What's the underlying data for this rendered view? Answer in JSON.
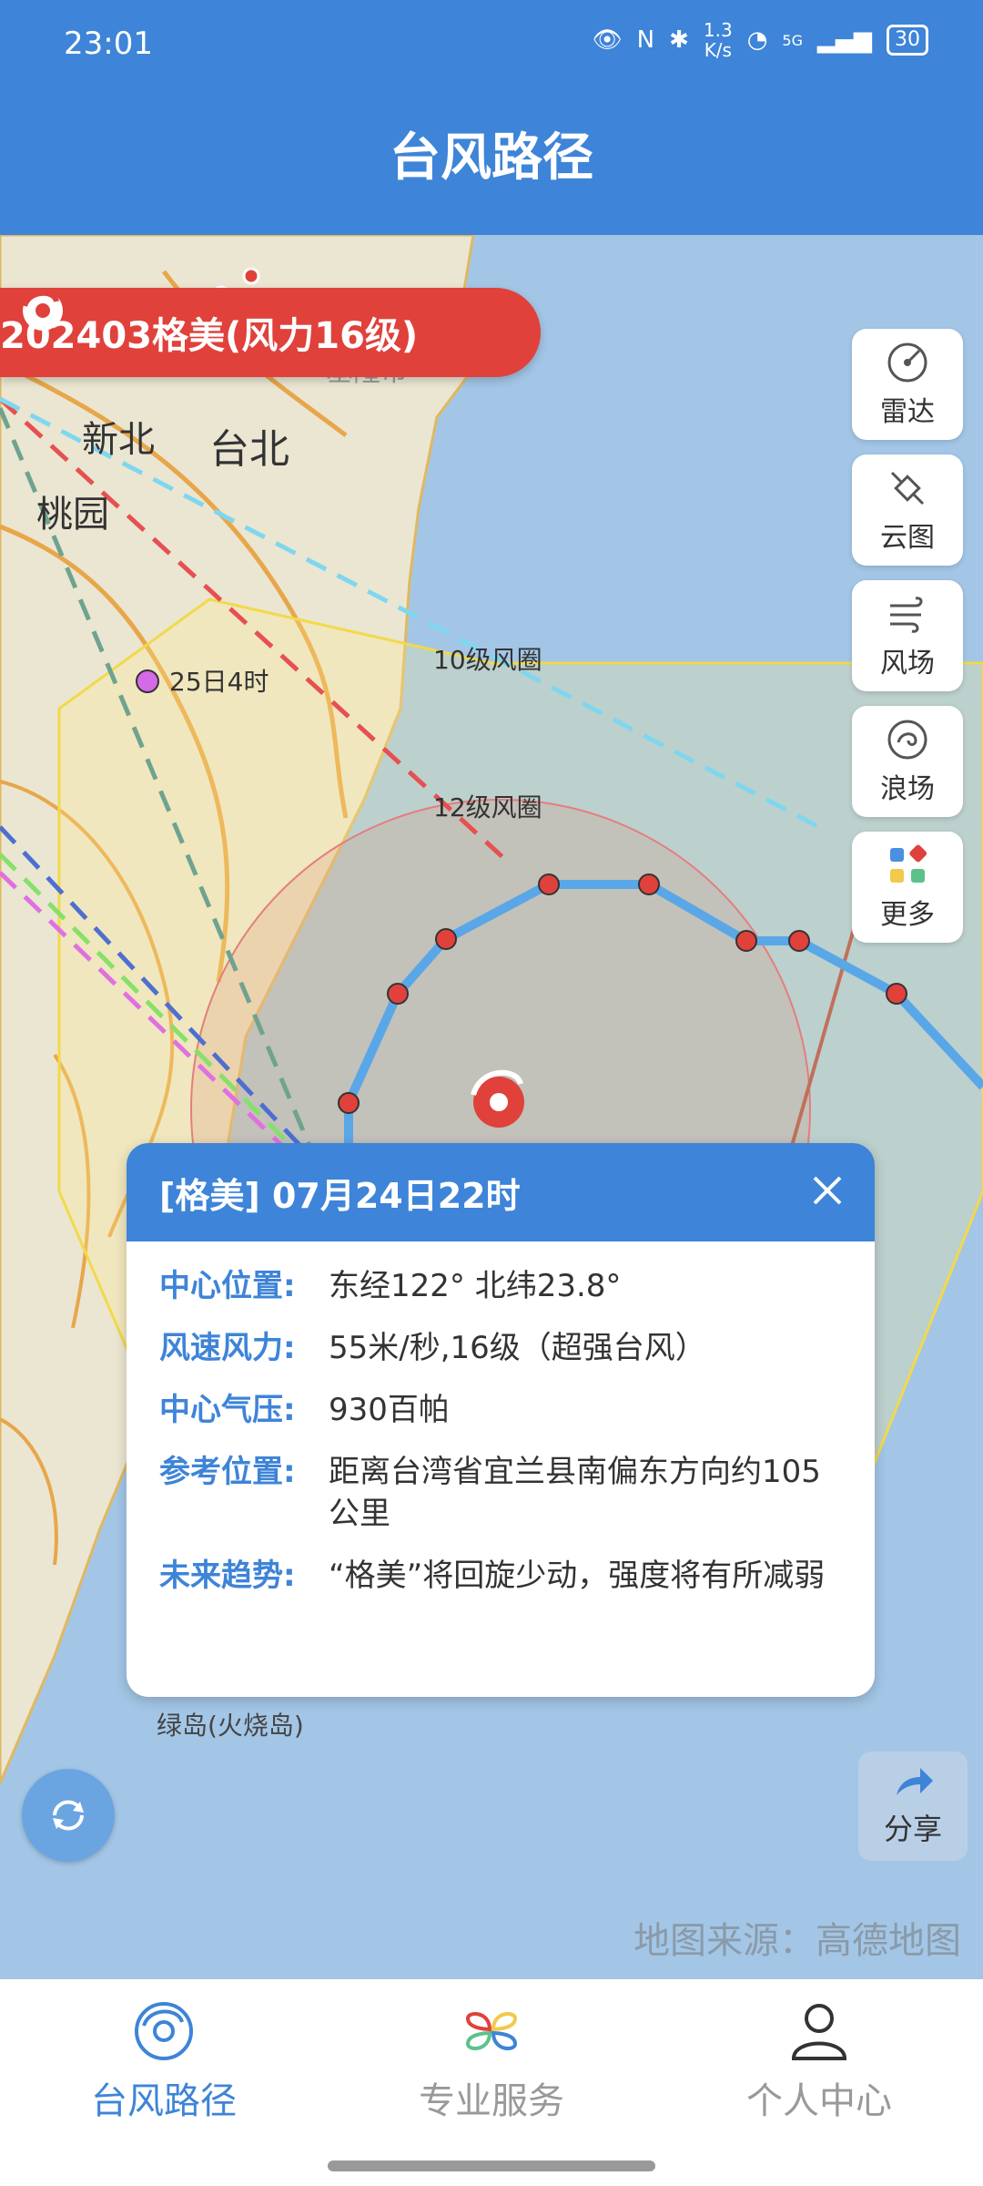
{
  "status_bar": {
    "time": "23:01",
    "speed_top": "1.3",
    "speed_unit": "K/s",
    "network": "5G",
    "battery": "30"
  },
  "header": {
    "title": "台风路径"
  },
  "typhoon": {
    "banner": "202403格美(风力16级)"
  },
  "map_labels": {
    "keelung": "基隆市",
    "new_taipei": "新北",
    "taipei": "台北",
    "taoyuan": "桃园",
    "point_time": "25日4时",
    "wind10": "10级风圈",
    "wind12": "12级风圈",
    "green_island": "绿岛(火烧岛)"
  },
  "tools": [
    {
      "label": "雷达",
      "icon": "radar-icon"
    },
    {
      "label": "云图",
      "icon": "satellite-icon"
    },
    {
      "label": "风场",
      "icon": "wind-icon"
    },
    {
      "label": "浪场",
      "icon": "wave-icon"
    },
    {
      "label": "更多",
      "icon": "more-icon"
    }
  ],
  "popup": {
    "title": "[格美] 07月24日22时",
    "rows": [
      {
        "label": "中心位置:",
        "value": "东经122° 北纬23.8°"
      },
      {
        "label": "风速风力:",
        "value": "55米/秒,16级（超强台风）"
      },
      {
        "label": "中心气压:",
        "value": "930百帕"
      },
      {
        "label": "参考位置:",
        "value": "距离台湾省宜兰县南偏东方向约105公里"
      },
      {
        "label": "未来趋势:",
        "value": "“格美”将回旋少动，强度将有所减弱"
      }
    ]
  },
  "share": {
    "label": "分享"
  },
  "map_source": "地图来源：高德地图",
  "nav": [
    {
      "label": "台风路径",
      "active_color": "#3e84d8"
    },
    {
      "label": "专业服务",
      "color": "#999999"
    },
    {
      "label": "个人中心",
      "color": "#999999"
    }
  ],
  "colors": {
    "accent": "#3e84d8",
    "typhoon_red": "#e0413b",
    "track_blue": "#5aa7e8"
  }
}
